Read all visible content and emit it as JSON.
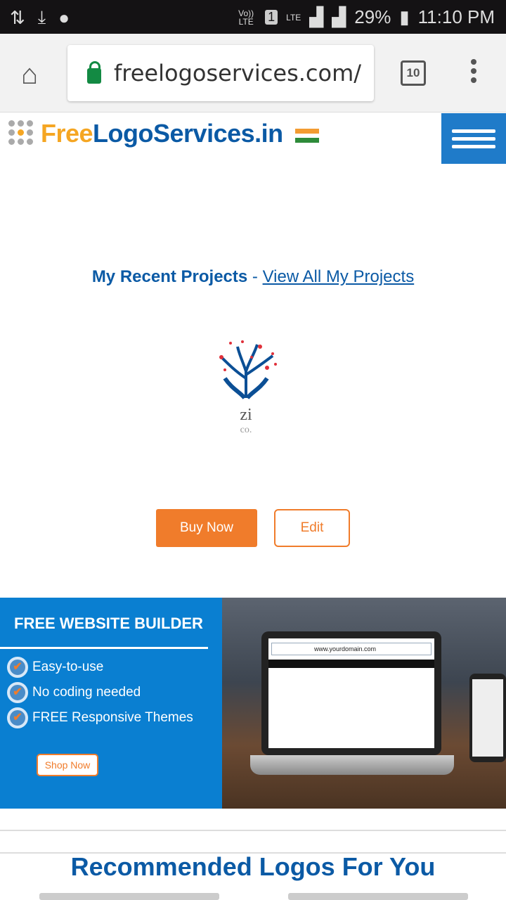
{
  "status_bar": {
    "network_label": "Vo)) LTE",
    "sim": "1",
    "lte": "LTE",
    "battery": "29%",
    "time": "11:10 PM"
  },
  "browser": {
    "url": "freelogoservices.com/",
    "tab_count": "10"
  },
  "site": {
    "brand_free": "Free",
    "brand_rest": "LogoServices.in"
  },
  "recent": {
    "title": "My Recent Projects",
    "separator": " - ",
    "view_all": "View All My Projects"
  },
  "project": {
    "logo_name": "zi",
    "logo_tagline": "co.",
    "buy_label": "Buy Now",
    "edit_label": "Edit"
  },
  "promo": {
    "title": "FREE WEBSITE BUILDER",
    "features": [
      "Easy-to-use",
      "No coding needed",
      "FREE Responsive Themes"
    ],
    "shop_label": "Shop Now",
    "mock_url": "www.yourdomain.com"
  },
  "recommended": {
    "title": "Recommended Logos For You"
  },
  "colors": {
    "brand_blue": "#0b5aa5",
    "accent_orange": "#f07c2b",
    "promo_blue": "#0a7fd1"
  }
}
